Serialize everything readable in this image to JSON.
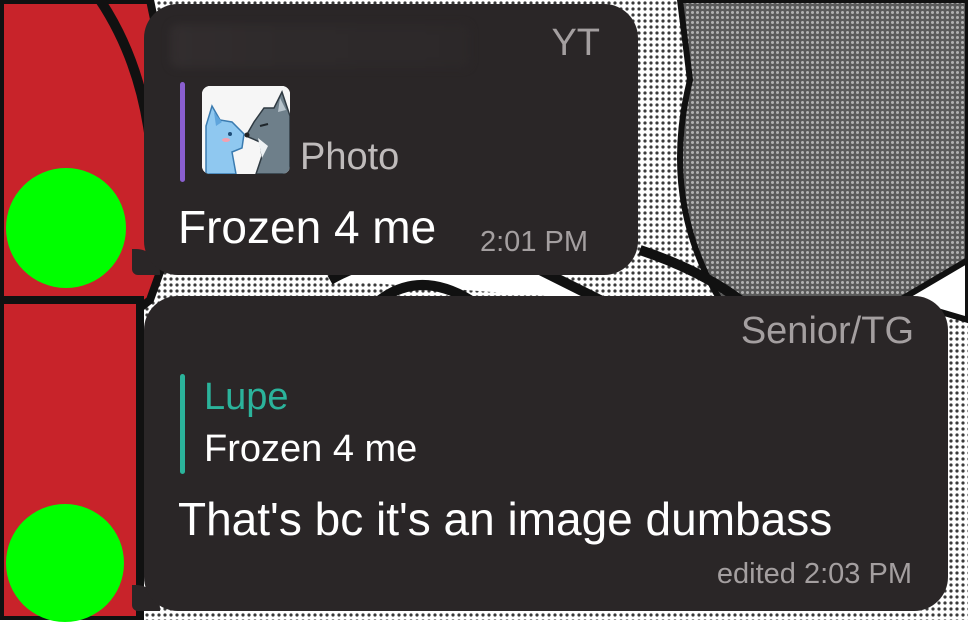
{
  "messages": [
    {
      "sender_tag": "YT",
      "reply": {
        "label": "Photo"
      },
      "text": "Frozen 4 me",
      "time": "2:01 PM"
    },
    {
      "sender_tag": "Senior/TG",
      "reply": {
        "name": "Lupe",
        "text": "Frozen 4 me"
      },
      "text": "That's bc it's an image dumbass",
      "time": "edited 2:03 PM"
    }
  ],
  "colors": {
    "bubble": "#2a2627",
    "avatar": "#00ff00",
    "reply_bar_1": "#8a5fd0",
    "reply_accent_2": "#2bb39b",
    "meta_text": "#a49fa0",
    "wallpaper_red": "#c8232a"
  },
  "icons": {
    "thumbnail": "wolf-sticker-image"
  }
}
